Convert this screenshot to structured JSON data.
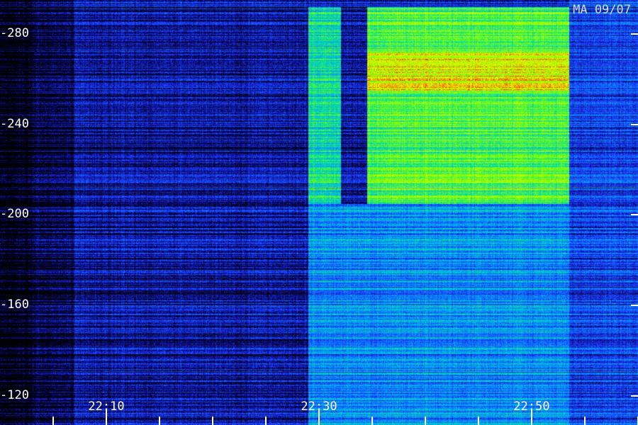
{
  "station_label": "MA 09/07",
  "chart_data": {
    "type": "heatmap",
    "title": "",
    "xlabel": "",
    "ylabel": "",
    "y_ticks": [
      120,
      160,
      200,
      240,
      280
    ],
    "y_tick_labels": [
      "-120",
      "-160",
      "-200",
      "-240",
      "-280"
    ],
    "ylim": [
      107,
      295
    ],
    "x_tick_labels": [
      "22:10",
      "22:30",
      "22:50"
    ],
    "x_tick_minutes": [
      10,
      30,
      50
    ],
    "x_minor_tick_minutes": [
      5,
      10,
      15,
      20,
      25,
      30,
      35,
      40,
      45,
      50,
      55,
      60
    ],
    "xlim_minutes": [
      0,
      60
    ],
    "colormap": [
      "#000000",
      "#0a0a80",
      "#1e3cff",
      "#00a0ff",
      "#00e0a0",
      "#7cff00",
      "#e8ff00",
      "#ff2000"
    ],
    "intensity_regions": [
      {
        "t_start": 29.0,
        "t_end": 32.0,
        "f_low": 205,
        "f_high": 292,
        "level": 0.58
      },
      {
        "t_start": 34.5,
        "t_end": 53.5,
        "f_low": 205,
        "f_high": 292,
        "level": 0.68
      },
      {
        "t_start": 34.5,
        "t_end": 53.5,
        "f_low": 255,
        "f_high": 272,
        "level": 0.85
      },
      {
        "t_start": 29.0,
        "t_end": 53.5,
        "f_low": 107,
        "f_high": 205,
        "level": 0.42
      },
      {
        "t_start": 7.0,
        "t_end": 29.0,
        "f_low": 107,
        "f_high": 295,
        "level": 0.2
      },
      {
        "t_start": 53.5,
        "t_end": 60.0,
        "f_low": 107,
        "f_high": 295,
        "level": 0.3
      }
    ]
  }
}
